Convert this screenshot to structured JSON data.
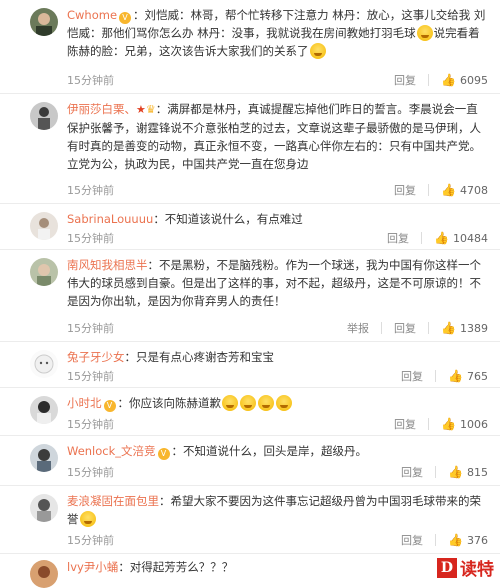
{
  "comments": [
    {
      "user": "Cwhome",
      "text_parts": [
        "：刘恺威：林哥，帮个忙转移下注意力 林丹：放心，这事儿交给我 刘恺威：那他们骂你怎么办 林丹：没事，我就说我在房间教她打羽毛球",
        "说完看着陈赫的脸：兄弟，这次该告诉大家我们的关系了"
      ],
      "time": "15分钟前",
      "report": "",
      "reply": "回复",
      "likes": "6095"
    },
    {
      "user": "伊丽莎白栗、",
      "text": "：满屏都是林丹，真诚提醒忘掉他们昨日的誓言。李晨说会一直保护张馨予，谢霆锋说不介意张柏芝的过去，文章说这辈子最骄傲的是马伊琍，人有时真的是善变的动物，真正永恒不变，一路真心伴你左右的：只有中国共产党。立党为公，执政为民，中国共产党一直在您身边",
      "time": "15分钟前",
      "report": "",
      "reply": "回复",
      "likes": "4708"
    },
    {
      "user": "SabrinaLouuuu",
      "text": "：不知道该说什么，有点难过",
      "time": "15分钟前",
      "report": "",
      "reply": "回复",
      "likes": "10484"
    },
    {
      "user": "南风知我相思半",
      "text": "：不是黑粉，不是脑残粉。作为一个球迷，我为中国有你这样一个伟大的球员感到自豪。但是出了这样的事，对不起，超级丹，这是不可原谅的！不是因为你出轨，是因为你背弃男人的责任！",
      "time": "15分钟前",
      "report": "举报",
      "reply": "回复",
      "likes": "1389"
    },
    {
      "user": "兔子牙少女",
      "text": "：只是有点心疼谢杏芳和宝宝",
      "time": "15分钟前",
      "report": "",
      "reply": "回复",
      "likes": "765"
    },
    {
      "user": "小时北",
      "text": "：你应该向陈赫道歉",
      "time": "15分钟前",
      "report": "",
      "reply": "回复",
      "likes": "1006"
    },
    {
      "user": "Wenlock_文涪竞",
      "text": "：不知道说什么，回头是岸，超级丹。",
      "time": "15分钟前",
      "report": "",
      "reply": "回复",
      "likes": "815"
    },
    {
      "user": "麦浪凝固在面包里",
      "text": "：希望大家不要因为这件事忘记超级丹曾为中国羽毛球带来的荣誉",
      "time": "15分钟前",
      "report": "",
      "reply": "回复",
      "likes": "376"
    },
    {
      "user": "lvy尹小蛹",
      "text": "：对得起芳芳么？？？",
      "time": "",
      "report": "",
      "reply": "",
      "likes": ""
    }
  ],
  "watermark": {
    "box": "D",
    "text": "读特"
  },
  "colors": {
    "username": "#eb7350",
    "meta": "#999999",
    "watermark": "#d7261e"
  }
}
